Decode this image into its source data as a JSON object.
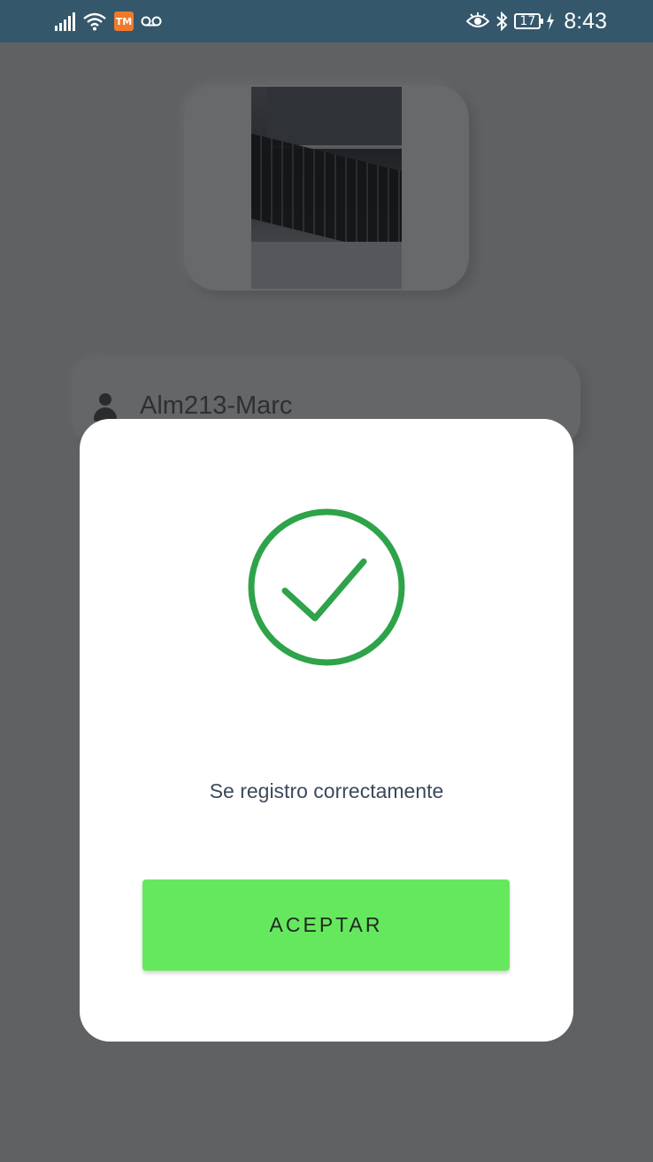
{
  "status_bar": {
    "time": "8:43",
    "battery_level": "17",
    "app_badge": "TM",
    "icons": [
      "signal-icon",
      "wifi-icon",
      "app-badge-icon",
      "voicemail-icon",
      "eye-icon",
      "bluetooth-icon",
      "battery-icon",
      "charging-icon"
    ]
  },
  "background": {
    "photo_description": "laptop-photo",
    "user_name": "Alm213-Marc"
  },
  "dialog": {
    "status_icon": "check-circle-icon",
    "message": "Se registro correctamente",
    "accept_label": "ACEPTAR"
  },
  "colors": {
    "status_bar": "#34576b",
    "success_green": "#2ea34a",
    "button_green": "#66e85e",
    "overlay": "#5f6163"
  }
}
